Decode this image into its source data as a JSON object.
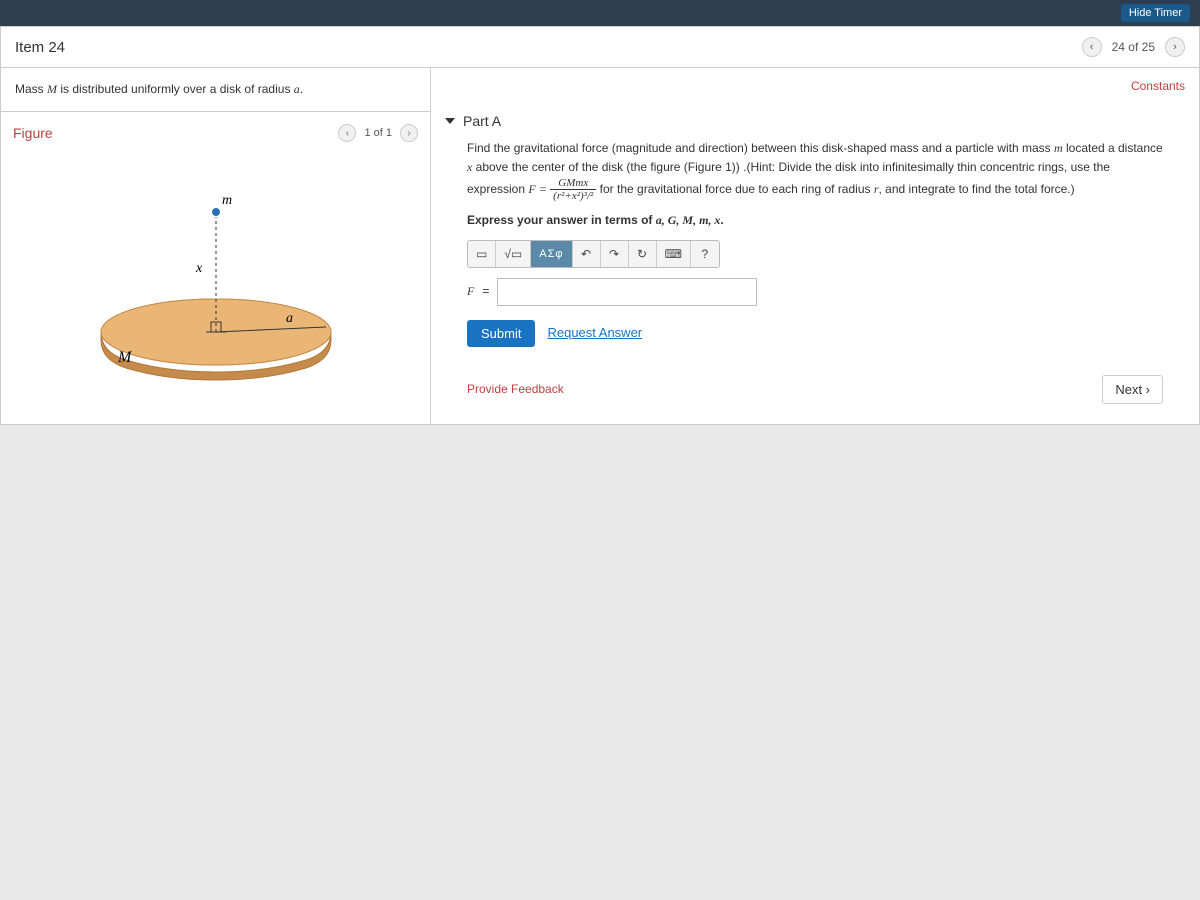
{
  "topbar": {
    "hide_timer": "Hide Timer"
  },
  "item_header": {
    "title": "Item 24",
    "prev_char": "‹",
    "count": "24 of 25",
    "next_char": "›"
  },
  "left": {
    "prompt_prefix": "Mass ",
    "prompt_mass": "M",
    "prompt_mid": " is distributed uniformly over a disk of radius ",
    "prompt_rad": "a",
    "prompt_end": ".",
    "figure_title": "Figure",
    "figure_prev": "‹",
    "figure_count": "1 of 1",
    "figure_next": "›",
    "labels": {
      "m": "m",
      "x": "x",
      "a": "a",
      "M": "M"
    }
  },
  "right": {
    "constants": "Constants",
    "part_label": "Part A",
    "body1": "Find the gravitational force (magnitude and direction) between this disk-shaped mass and a particle with mass ",
    "body_m": "m",
    "body2": " located a distance ",
    "body_x": "x",
    "body3": " above the center of the disk (the figure (Figure 1)) .(Hint: Divide the disk into infinitesimally thin concentric rings, use the expression ",
    "body_Feq": "F =",
    "frac_num": "GMmx",
    "frac_den": "(r²+x²)³/²",
    "body4": " for the gravitational force due to each ring of radius ",
    "body_r": "r",
    "body5": ", and integrate to find the total force.)",
    "express": "Express your answer in terms of ",
    "express_vars": "a, G, M, m, x",
    "express_end": ".",
    "tb_template": "▭",
    "tb_sqrt": "√▭",
    "tb_greek": "ΑΣφ",
    "tb_undo": "↶",
    "tb_redo": "↷",
    "tb_reset": "↻",
    "tb_keyboard": "⌨",
    "tb_help": "?",
    "F_label": "F",
    "equals": " = ",
    "submit": "Submit",
    "request_answer": "Request Answer",
    "provide_feedback": "Provide Feedback",
    "next": "Next ›"
  }
}
